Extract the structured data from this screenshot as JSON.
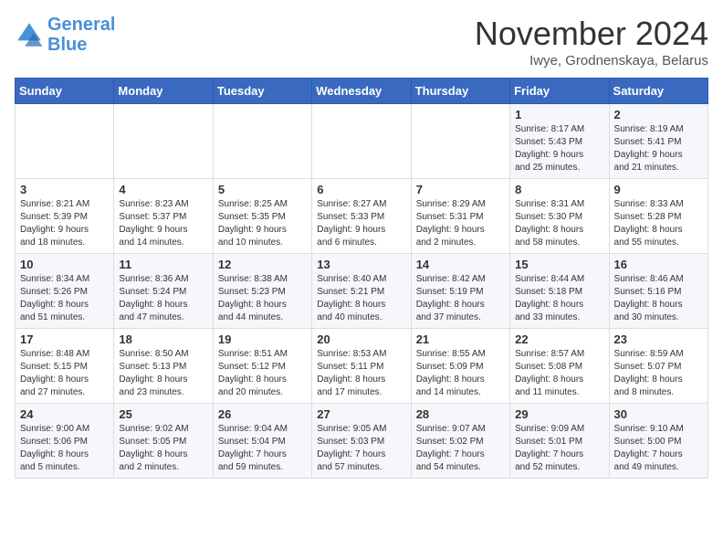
{
  "logo": {
    "line1": "General",
    "line2": "Blue"
  },
  "title": "November 2024",
  "subtitle": "Iwye, Grodnenskaya, Belarus",
  "days_of_week": [
    "Sunday",
    "Monday",
    "Tuesday",
    "Wednesday",
    "Thursday",
    "Friday",
    "Saturday"
  ],
  "weeks": [
    [
      {
        "day": "",
        "info": ""
      },
      {
        "day": "",
        "info": ""
      },
      {
        "day": "",
        "info": ""
      },
      {
        "day": "",
        "info": ""
      },
      {
        "day": "",
        "info": ""
      },
      {
        "day": "1",
        "info": "Sunrise: 8:17 AM\nSunset: 5:43 PM\nDaylight: 9 hours\nand 25 minutes."
      },
      {
        "day": "2",
        "info": "Sunrise: 8:19 AM\nSunset: 5:41 PM\nDaylight: 9 hours\nand 21 minutes."
      }
    ],
    [
      {
        "day": "3",
        "info": "Sunrise: 8:21 AM\nSunset: 5:39 PM\nDaylight: 9 hours\nand 18 minutes."
      },
      {
        "day": "4",
        "info": "Sunrise: 8:23 AM\nSunset: 5:37 PM\nDaylight: 9 hours\nand 14 minutes."
      },
      {
        "day": "5",
        "info": "Sunrise: 8:25 AM\nSunset: 5:35 PM\nDaylight: 9 hours\nand 10 minutes."
      },
      {
        "day": "6",
        "info": "Sunrise: 8:27 AM\nSunset: 5:33 PM\nDaylight: 9 hours\nand 6 minutes."
      },
      {
        "day": "7",
        "info": "Sunrise: 8:29 AM\nSunset: 5:31 PM\nDaylight: 9 hours\nand 2 minutes."
      },
      {
        "day": "8",
        "info": "Sunrise: 8:31 AM\nSunset: 5:30 PM\nDaylight: 8 hours\nand 58 minutes."
      },
      {
        "day": "9",
        "info": "Sunrise: 8:33 AM\nSunset: 5:28 PM\nDaylight: 8 hours\nand 55 minutes."
      }
    ],
    [
      {
        "day": "10",
        "info": "Sunrise: 8:34 AM\nSunset: 5:26 PM\nDaylight: 8 hours\nand 51 minutes."
      },
      {
        "day": "11",
        "info": "Sunrise: 8:36 AM\nSunset: 5:24 PM\nDaylight: 8 hours\nand 47 minutes."
      },
      {
        "day": "12",
        "info": "Sunrise: 8:38 AM\nSunset: 5:23 PM\nDaylight: 8 hours\nand 44 minutes."
      },
      {
        "day": "13",
        "info": "Sunrise: 8:40 AM\nSunset: 5:21 PM\nDaylight: 8 hours\nand 40 minutes."
      },
      {
        "day": "14",
        "info": "Sunrise: 8:42 AM\nSunset: 5:19 PM\nDaylight: 8 hours\nand 37 minutes."
      },
      {
        "day": "15",
        "info": "Sunrise: 8:44 AM\nSunset: 5:18 PM\nDaylight: 8 hours\nand 33 minutes."
      },
      {
        "day": "16",
        "info": "Sunrise: 8:46 AM\nSunset: 5:16 PM\nDaylight: 8 hours\nand 30 minutes."
      }
    ],
    [
      {
        "day": "17",
        "info": "Sunrise: 8:48 AM\nSunset: 5:15 PM\nDaylight: 8 hours\nand 27 minutes."
      },
      {
        "day": "18",
        "info": "Sunrise: 8:50 AM\nSunset: 5:13 PM\nDaylight: 8 hours\nand 23 minutes."
      },
      {
        "day": "19",
        "info": "Sunrise: 8:51 AM\nSunset: 5:12 PM\nDaylight: 8 hours\nand 20 minutes."
      },
      {
        "day": "20",
        "info": "Sunrise: 8:53 AM\nSunset: 5:11 PM\nDaylight: 8 hours\nand 17 minutes."
      },
      {
        "day": "21",
        "info": "Sunrise: 8:55 AM\nSunset: 5:09 PM\nDaylight: 8 hours\nand 14 minutes."
      },
      {
        "day": "22",
        "info": "Sunrise: 8:57 AM\nSunset: 5:08 PM\nDaylight: 8 hours\nand 11 minutes."
      },
      {
        "day": "23",
        "info": "Sunrise: 8:59 AM\nSunset: 5:07 PM\nDaylight: 8 hours\nand 8 minutes."
      }
    ],
    [
      {
        "day": "24",
        "info": "Sunrise: 9:00 AM\nSunset: 5:06 PM\nDaylight: 8 hours\nand 5 minutes."
      },
      {
        "day": "25",
        "info": "Sunrise: 9:02 AM\nSunset: 5:05 PM\nDaylight: 8 hours\nand 2 minutes."
      },
      {
        "day": "26",
        "info": "Sunrise: 9:04 AM\nSunset: 5:04 PM\nDaylight: 7 hours\nand 59 minutes."
      },
      {
        "day": "27",
        "info": "Sunrise: 9:05 AM\nSunset: 5:03 PM\nDaylight: 7 hours\nand 57 minutes."
      },
      {
        "day": "28",
        "info": "Sunrise: 9:07 AM\nSunset: 5:02 PM\nDaylight: 7 hours\nand 54 minutes."
      },
      {
        "day": "29",
        "info": "Sunrise: 9:09 AM\nSunset: 5:01 PM\nDaylight: 7 hours\nand 52 minutes."
      },
      {
        "day": "30",
        "info": "Sunrise: 9:10 AM\nSunset: 5:00 PM\nDaylight: 7 hours\nand 49 minutes."
      }
    ]
  ]
}
